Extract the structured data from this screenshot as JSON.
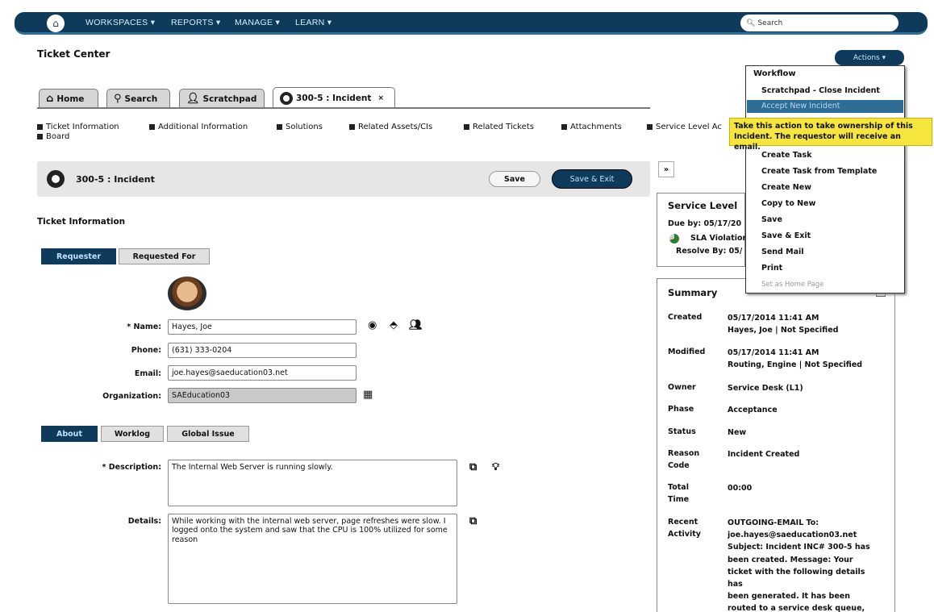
{
  "nav": {
    "items": [
      "WORKSPACES ▾",
      "REPORTS ▾",
      "MANAGE ▾",
      "LEARN ▾"
    ],
    "search_label": "Search"
  },
  "page": {
    "title": "Ticket Center",
    "actions_label": "Actions ▾"
  },
  "tabs": [
    "Home",
    "Search",
    "Scratchpad",
    "300-5 : Incident"
  ],
  "tab_close": "×",
  "section_links": [
    "Ticket Information",
    "Additional Information",
    "Solutions",
    "Related Assets/CIs",
    "Related Tickets",
    "Attachments",
    "Service Level Ac",
    "Board"
  ],
  "incident": {
    "header": "300-5 : Incident",
    "save_label": "Save",
    "save_exit_label": "Save & Exit",
    "collapse_label": "»"
  },
  "ticket_info": {
    "heading": "Ticket Information",
    "subtabs": [
      "Requester",
      "Requested For"
    ],
    "fields": {
      "name_label": "* Name:",
      "name_value": "Hayes, Joe",
      "phone_label": "Phone:",
      "phone_value": "(631) 333-0204",
      "email_label": "Email:",
      "email_value": "joe.hayes@saeducation03.net",
      "org_label": "Organization:",
      "org_value": "SAEducation03"
    }
  },
  "about": {
    "subtabs": [
      "About",
      "Worklog",
      "Global Issue"
    ],
    "description_label": "* Description:",
    "description_value": "The Internal Web Server is running slowly.",
    "details_label": "Details:",
    "details_value": "While working with the internal web server, page refreshes were slow.   I logged onto the system and saw that the CPU is 100% utilized for some reason"
  },
  "service_level": {
    "title": "Service Level",
    "due_by": "Due by: 05/17/20",
    "sla": "SLA Violation",
    "resolve_by": "Resolve By: 05/"
  },
  "summary": {
    "title": "Summary",
    "rows": [
      {
        "label": "Created",
        "value": "05/17/2014 11:41 AM\nHayes, Joe | Not Specified"
      },
      {
        "label": "Modified",
        "value": "05/17/2014 11:41 AM\nRouting, Engine | Not Specified"
      },
      {
        "label": "Owner",
        "value": "Service Desk (L1)"
      },
      {
        "label": "Phase",
        "value": "Acceptance"
      },
      {
        "label": "Status",
        "value": "New"
      },
      {
        "label": "Reason\nCode",
        "value": "Incident Created"
      },
      {
        "label": "Total\nTime",
        "value": "00:00"
      },
      {
        "label": "Recent\nActivity",
        "value": "OUTGOING-EMAIL To:\njoe.hayes@saeducation03.net\nSubject: Incident INC# 300-5 has\nbeen created. Message: Your\nticket with the following details has\nbeen generated. It has been\nrouted to a service desk queue,\nand will be addressed as soon as"
      }
    ]
  },
  "actions_menu": {
    "heading": "Workflow",
    "items": [
      "Scratchpad - Close Incident",
      "Accept New Incident",
      "Create Task",
      "Create Task from Template",
      "Create New",
      "Copy to New",
      "Save",
      "Save & Exit",
      "Send Mail",
      "Print",
      "Set as Home Page"
    ],
    "tooltip": "Take this action to take ownership of this Incident. The requestor will receive an email."
  },
  "colors": {
    "nav": "#0e3b5c",
    "highlight": "#2e6d96",
    "tooltip": "#f5e53c"
  }
}
